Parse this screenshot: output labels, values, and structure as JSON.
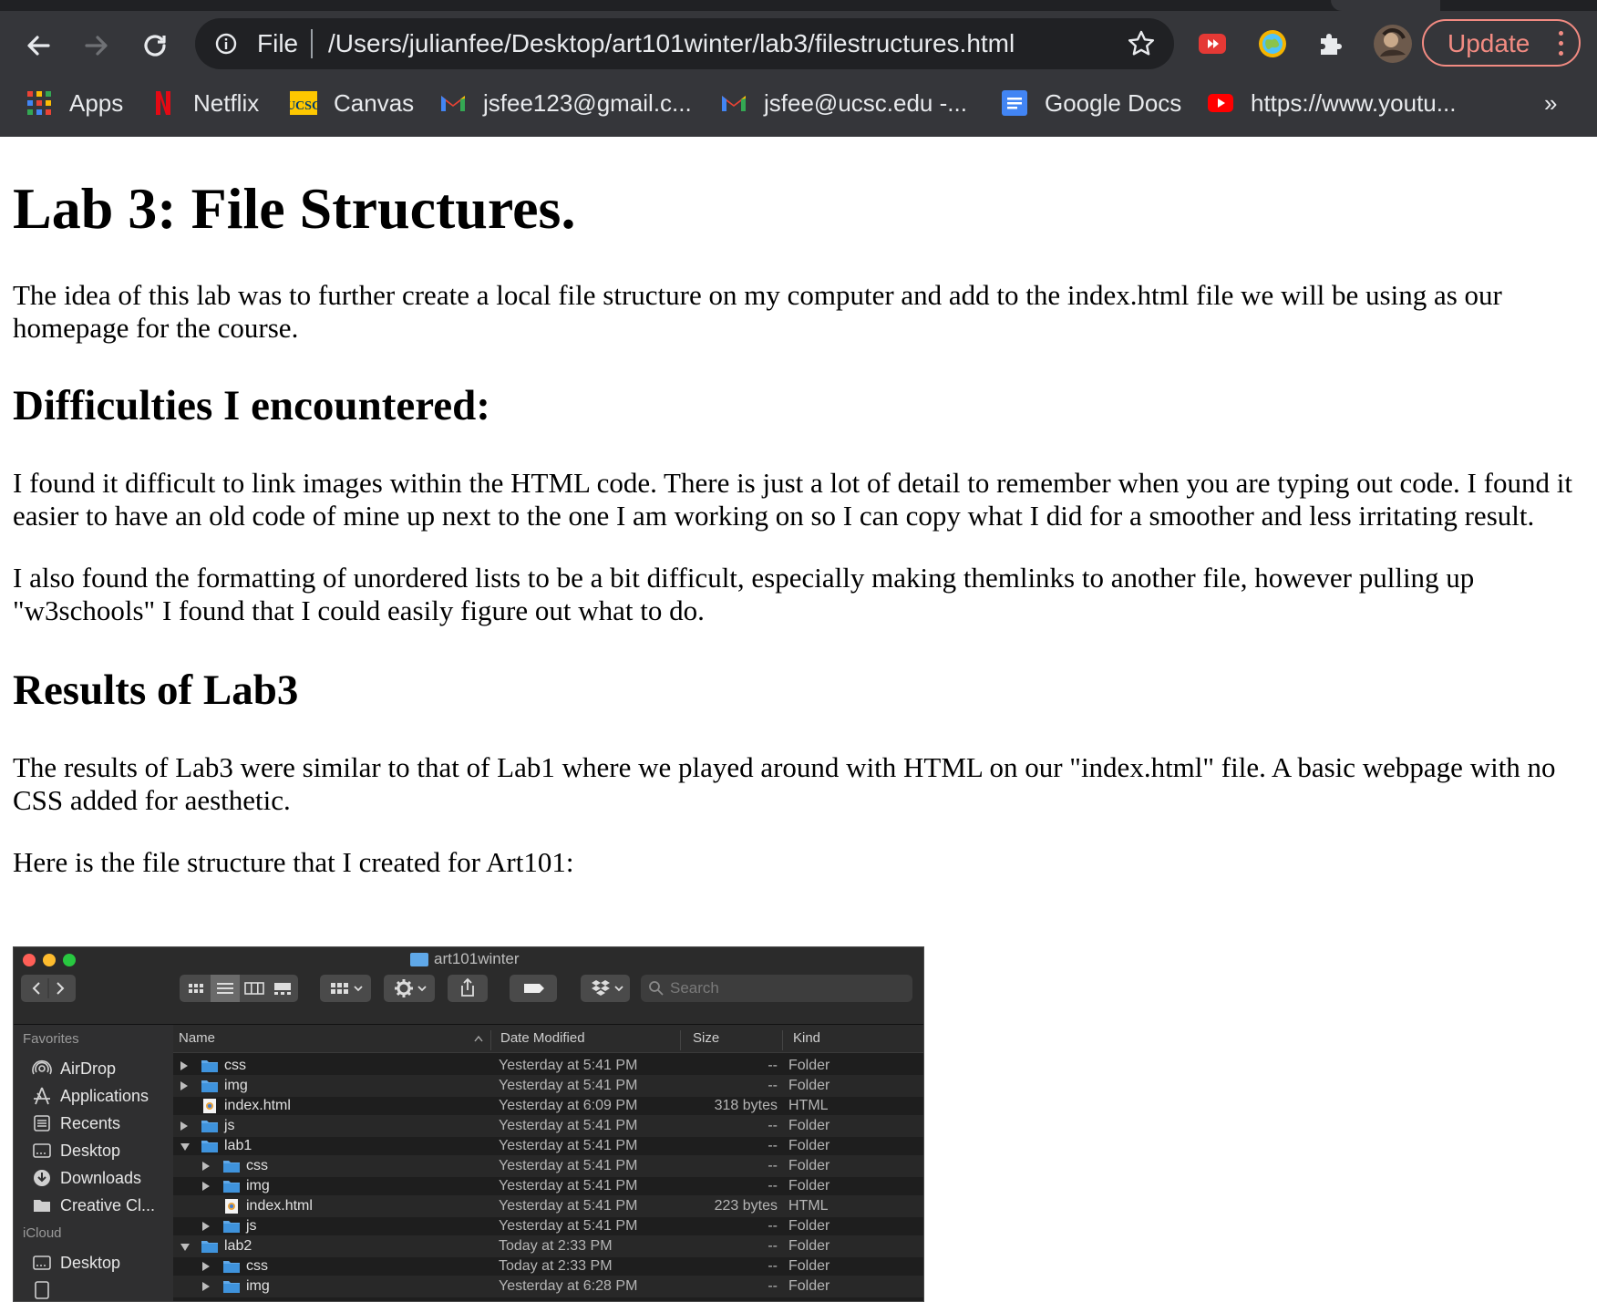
{
  "browser": {
    "address_scheme": "File",
    "url": "/Users/julianfee/Desktop/art101winter/lab3/filestructures.html",
    "update_label": "Update",
    "bookmarks": [
      {
        "label": "Apps",
        "icon": "apps-grid-icon"
      },
      {
        "label": "Netflix",
        "icon": "netflix-icon"
      },
      {
        "label": "Canvas",
        "icon": "ucsc-canvas-icon"
      },
      {
        "label": "jsfee123@gmail.c...",
        "icon": "gmail-icon"
      },
      {
        "label": "jsfee@ucsc.edu -...",
        "icon": "gmail-icon"
      },
      {
        "label": "Google Docs",
        "icon": "google-docs-icon"
      },
      {
        "label": "https://www.youtu...",
        "icon": "youtube-icon"
      }
    ],
    "bookmarks_overflow": "»",
    "colors": {
      "chrome": "#35363a",
      "omnibox": "#202124",
      "update_accent": "#f28b82"
    }
  },
  "page": {
    "title": "Lab 3: File Structures.",
    "intro": "The idea of this lab was to further create a local file structure on my computer and add to the index.html file we will be using as our homepage for the course.",
    "difficulties_heading": "Difficulties I encountered:",
    "difficulties_p1": "I found it difficult to link images within the HTML code. There is just a lot of detail to remember when you are typing out code. I found it easier to have an old code of mine up next to the one I am working on so I can copy what I did for a smoother and less irritating result.",
    "difficulties_p2": "I also found the formatting of unordered lists to be a bit difficult, especially making themlinks to another file, however pulling up \"w3schools\" I found that I could easily figure out what to do.",
    "results_heading": "Results of Lab3",
    "results_p1": "The results of Lab3 were similar to that of Lab1 where we played around with HTML on our \"index.html\" file. A basic webpage with no CSS added for aesthetic.",
    "results_p2": "Here is the file structure that I created for Art101:"
  },
  "finder": {
    "window_title": "art101winter",
    "search_placeholder": "Search",
    "sidebar": {
      "favorites_label": "Favorites",
      "favorites": [
        {
          "label": "AirDrop",
          "icon": "airdrop-icon"
        },
        {
          "label": "Applications",
          "icon": "applications-icon"
        },
        {
          "label": "Recents",
          "icon": "recents-icon"
        },
        {
          "label": "Desktop",
          "icon": "desktop-icon"
        },
        {
          "label": "Downloads",
          "icon": "downloads-icon"
        },
        {
          "label": "Creative Cl...",
          "icon": "folder-icon"
        }
      ],
      "icloud_label": "iCloud",
      "icloud": [
        {
          "label": "Desktop",
          "icon": "desktop-icon"
        }
      ]
    },
    "columns": {
      "name": "Name",
      "date": "Date Modified",
      "size": "Size",
      "kind": "Kind"
    },
    "rows": [
      {
        "name": "css",
        "indent": 0,
        "disclosure": "collapsed",
        "type": "folder",
        "date": "Yesterday at 5:41 PM",
        "size": "--",
        "kind": "Folder"
      },
      {
        "name": "img",
        "indent": 0,
        "disclosure": "collapsed",
        "type": "folder",
        "date": "Yesterday at 5:41 PM",
        "size": "--",
        "kind": "Folder"
      },
      {
        "name": "index.html",
        "indent": 0,
        "disclosure": "none",
        "type": "file",
        "date": "Yesterday at 6:09 PM",
        "size": "318 bytes",
        "kind": "HTML"
      },
      {
        "name": "js",
        "indent": 0,
        "disclosure": "collapsed",
        "type": "folder",
        "date": "Yesterday at 5:41 PM",
        "size": "--",
        "kind": "Folder"
      },
      {
        "name": "lab1",
        "indent": 0,
        "disclosure": "expanded",
        "type": "folder",
        "date": "Yesterday at 5:41 PM",
        "size": "--",
        "kind": "Folder"
      },
      {
        "name": "css",
        "indent": 1,
        "disclosure": "collapsed",
        "type": "folder",
        "date": "Yesterday at 5:41 PM",
        "size": "--",
        "kind": "Folder"
      },
      {
        "name": "img",
        "indent": 1,
        "disclosure": "collapsed",
        "type": "folder",
        "date": "Yesterday at 5:41 PM",
        "size": "--",
        "kind": "Folder"
      },
      {
        "name": "index.html",
        "indent": 1,
        "disclosure": "none",
        "type": "file",
        "date": "Yesterday at 5:41 PM",
        "size": "223 bytes",
        "kind": "HTML"
      },
      {
        "name": "js",
        "indent": 1,
        "disclosure": "collapsed",
        "type": "folder",
        "date": "Yesterday at 5:41 PM",
        "size": "--",
        "kind": "Folder"
      },
      {
        "name": "lab2",
        "indent": 0,
        "disclosure": "expanded",
        "type": "folder",
        "date": "Today at 2:33 PM",
        "size": "--",
        "kind": "Folder"
      },
      {
        "name": "css",
        "indent": 1,
        "disclosure": "collapsed",
        "type": "folder",
        "date": "Today at 2:33 PM",
        "size": "--",
        "kind": "Folder"
      },
      {
        "name": "img",
        "indent": 1,
        "disclosure": "collapsed",
        "type": "folder",
        "date": "Yesterday at 6:28 PM",
        "size": "--",
        "kind": "Folder"
      }
    ],
    "colors": {
      "folder": "#5fa8e8",
      "close": "#ff5f57",
      "minimize": "#febc2e",
      "zoom": "#28c840"
    }
  }
}
